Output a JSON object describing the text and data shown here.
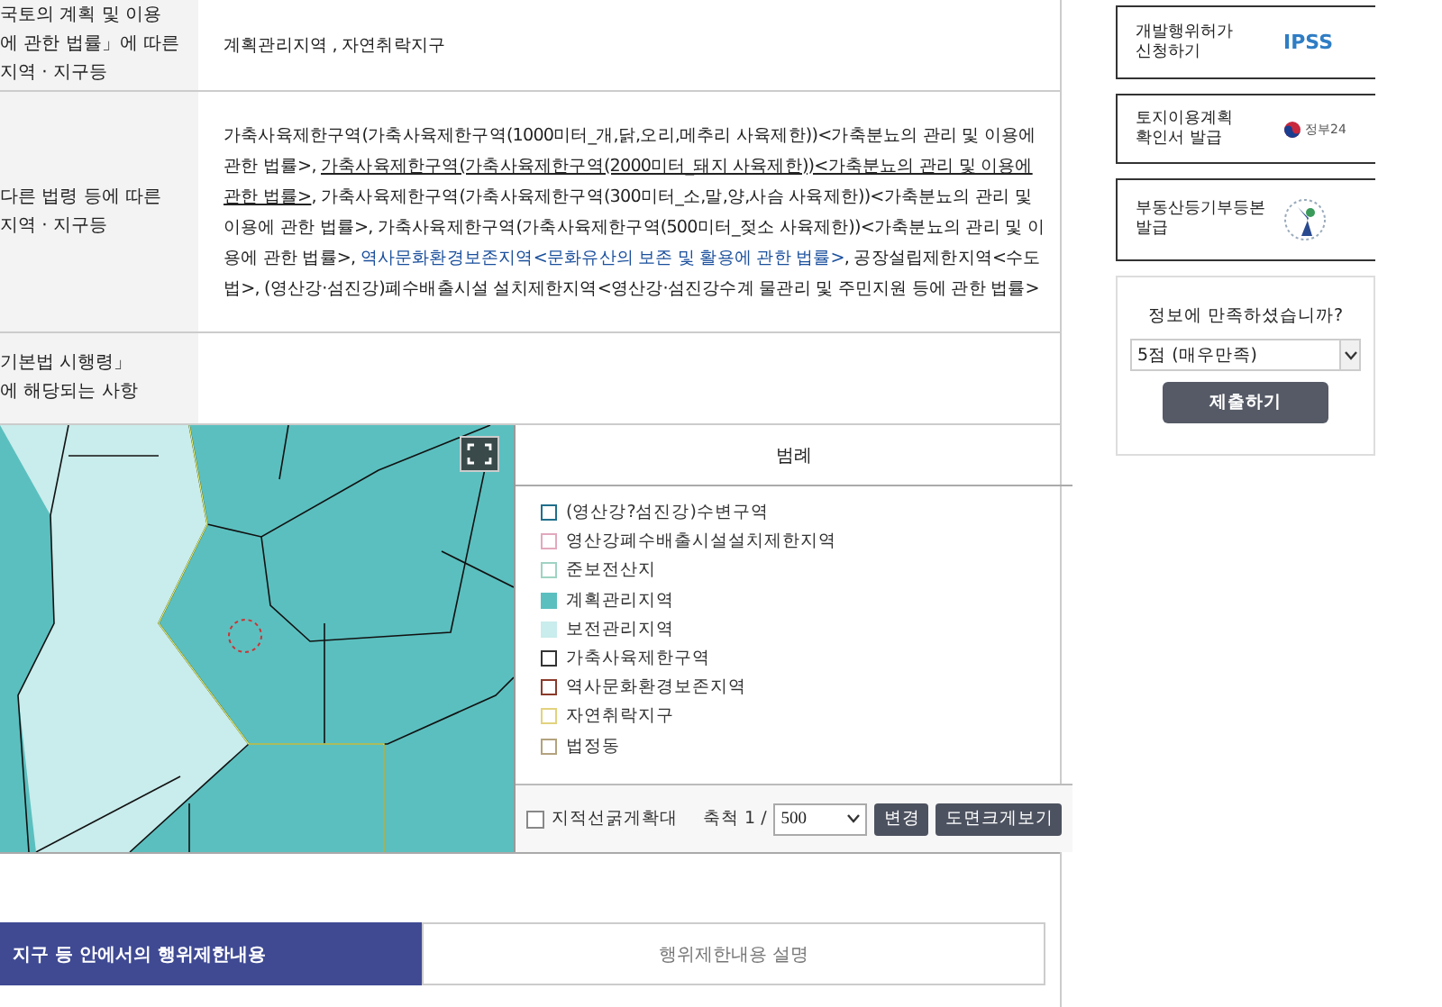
{
  "info_table": {
    "rows": [
      {
        "label": "국토의 계획 및 이용\n에 관한 법률」에 따른\n지역 · 지구등",
        "segments": [
          {
            "kind": "plain",
            "text": "계획관리지역 , 자연취락지구"
          }
        ]
      },
      {
        "label": "다른 법령 등에 따른\n지역 · 지구등",
        "segments": [
          {
            "kind": "plain",
            "text": "가축사육제한구역(가축사육제한구역(1000미터_개,닭,오리,메추리 사육제한))<가축분뇨의 관리 및 이용에 관한 법률>, "
          },
          {
            "kind": "underline",
            "text": "가축사육제한구역(가축사육제한구역(2000미터_돼지 사육제한))<가축분뇨의 관리 및 이용에 관한 법률>"
          },
          {
            "kind": "plain",
            "text": ", 가축사육제한구역(가축사육제한구역(300미터_소,말,양,사슴 사육제한))<가축분뇨의 관리 및 이용에 관한 법률>, 가축사육제한구역(가축사육제한구역(500미터_젖소 사육제한))<가축분뇨의 관리 및 이용에 관한 법률>, "
          },
          {
            "kind": "link",
            "text": "역사문화환경보존지역<문화유산의 보존 및 활용에 관한 법률>"
          },
          {
            "kind": "plain",
            "text": ", 공장설립제한지역<수도법>, (영산강·섬진강)폐수배출시설 설치제한지역<영산강·섬진강수계 물관리 및 주민지원 등에 관한 법률>"
          }
        ]
      },
      {
        "label": "기본법 시행령」\n에 해당되는 사항",
        "segments": []
      }
    ]
  },
  "legend": {
    "title": "범례",
    "items": [
      {
        "label": "(영산강?섬진강)수변구역",
        "kind": "outline",
        "color": "#1f6f8b"
      },
      {
        "label": "영산강폐수배출시설설치제한지역",
        "kind": "outline",
        "color": "#e3a9bd"
      },
      {
        "label": "준보전산지",
        "kind": "outline",
        "color": "#9fd3c3"
      },
      {
        "label": "계획관리지역",
        "kind": "fill",
        "color": "#5bbfbf"
      },
      {
        "label": "보전관리지역",
        "kind": "fill",
        "color": "#c9ecec"
      },
      {
        "label": "가축사육제한구역",
        "kind": "outline",
        "color": "#333333"
      },
      {
        "label": "역사문화환경보존지역",
        "kind": "outline",
        "color": "#8b3a2a"
      },
      {
        "label": "자연취락지구",
        "kind": "outline",
        "color": "#e2d27e"
      },
      {
        "label": "법정동",
        "kind": "outline",
        "color": "#b3a27e"
      }
    ],
    "checkbox": {
      "label": "지적선굵게확대",
      "checked": false
    },
    "scale_label": "축척 1 /",
    "scale_value": "500",
    "buttons": [
      "변경",
      "도면크게보기"
    ]
  },
  "tabs": [
    {
      "label": "지구 등 안에서의 행위제한내용",
      "selected": true
    },
    {
      "label": "행위제한내용 설명",
      "selected": false
    }
  ],
  "sidebar": {
    "cards": [
      {
        "kind": "ipss",
        "label": "개발행위허가\n신청하기",
        "logo_text": "IPSS"
      },
      {
        "kind": "gov24",
        "label": "토지이용계획\n확인서 발급",
        "logo_text": "정부24"
      },
      {
        "kind": "court",
        "label": "부동산등기부등본\n발급"
      }
    ],
    "survey": {
      "question": "정보에 만족하셨습니까?",
      "select_value": "5점 (매우만족)",
      "submit": "제출하기"
    }
  }
}
